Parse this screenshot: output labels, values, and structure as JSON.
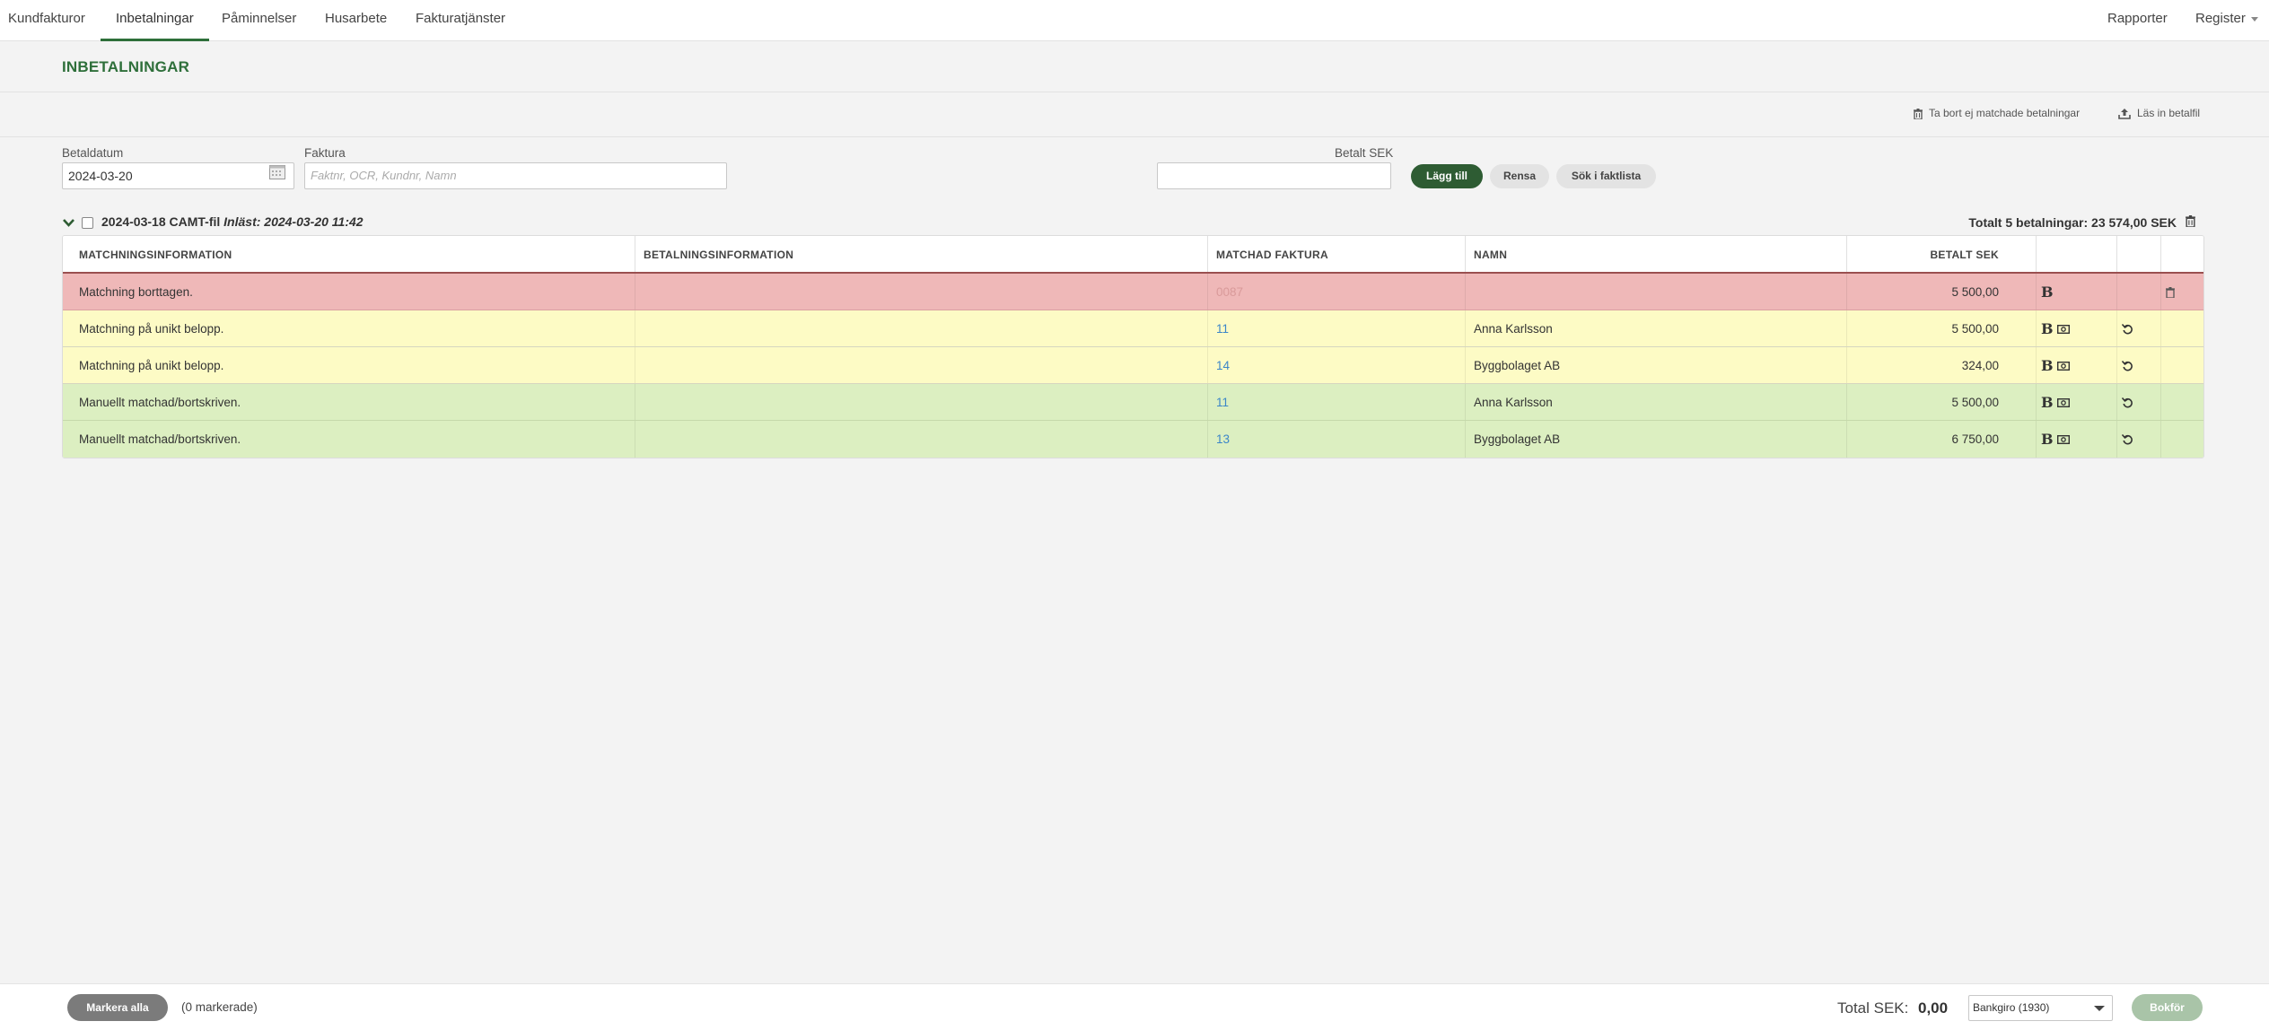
{
  "nav": {
    "tabs": [
      {
        "label": "Kundfakturor",
        "active": false
      },
      {
        "label": "Inbetalningar",
        "active": true
      },
      {
        "label": "Påminnelser",
        "active": false
      },
      {
        "label": "Husarbete",
        "active": false
      },
      {
        "label": "Fakturatjänster",
        "active": false
      }
    ],
    "reports": "Rapporter",
    "register": "Register"
  },
  "page": {
    "title": "INBETALNINGAR",
    "delete_unmatched": "Ta bort ej matchade betalningar",
    "import_file": "Läs in betalfil"
  },
  "form": {
    "date_label": "Betaldatum",
    "date_value": "2024-03-20",
    "invoice_label": "Faktura",
    "invoice_placeholder": "Faktnr, OCR, Kundnr, Namn",
    "paid_label": "Betalt SEK",
    "paid_value": "",
    "add_button": "Lägg till",
    "clear_button": "Rensa",
    "search_button": "Sök i faktlista"
  },
  "group": {
    "title": "2024-03-18 CAMT-fil",
    "loaded": "Inläst: 2024-03-20 11:42",
    "total": "Totalt 5 betalningar: 23 574,00 SEK"
  },
  "table": {
    "headers": {
      "matching": "MATCHNINGSINFORMATION",
      "payment": "BETALNINGSINFORMATION",
      "invoice": "MATCHAD FAKTURA",
      "name": "NAMN",
      "paid": "BETALT SEK"
    },
    "rows": [
      {
        "status": "red",
        "matching": "Matchning borttagen.",
        "payment": "",
        "invoice": "0087",
        "name": "",
        "paid": "5 500,00",
        "b_icon": "B",
        "has_receipt": false,
        "has_undo": false,
        "has_delete": true
      },
      {
        "status": "yellow",
        "matching": "Matchning på unikt belopp.",
        "payment": "",
        "invoice": "11",
        "name": "Anna Karlsson",
        "paid": "5 500,00",
        "b_icon": "B",
        "has_receipt": true,
        "has_undo": true,
        "has_delete": false
      },
      {
        "status": "yellow",
        "matching": "Matchning på unikt belopp.",
        "payment": "",
        "invoice": "14",
        "name": "Byggbolaget AB",
        "paid": "324,00",
        "b_icon": "B",
        "has_receipt": true,
        "has_undo": true,
        "has_delete": false
      },
      {
        "status": "green",
        "matching": "Manuellt matchad/bortskriven.",
        "payment": "",
        "invoice": "11",
        "name": "Anna Karlsson",
        "paid": "5 500,00",
        "b_icon": "B",
        "has_receipt": true,
        "has_undo": true,
        "has_delete": false
      },
      {
        "status": "green",
        "matching": "Manuellt matchad/bortskriven.",
        "payment": "",
        "invoice": "13",
        "name": "Byggbolaget AB",
        "paid": "6 750,00",
        "b_icon": "B",
        "has_receipt": true,
        "has_undo": true,
        "has_delete": false
      }
    ]
  },
  "footer": {
    "select_all": "Markera alla",
    "marked": "(0 markerade)",
    "total_label": "Total SEK:",
    "total_value": "0,00",
    "account": "Bankgiro (1930)",
    "book_button": "Bokför"
  },
  "colors": {
    "accent": "#2e6f3a",
    "primary_button": "#2e5c33",
    "row_removed": "#efb8b8",
    "row_unique": "#fdfbc5",
    "row_manual": "#dcefc1",
    "link": "#3c86c8"
  }
}
